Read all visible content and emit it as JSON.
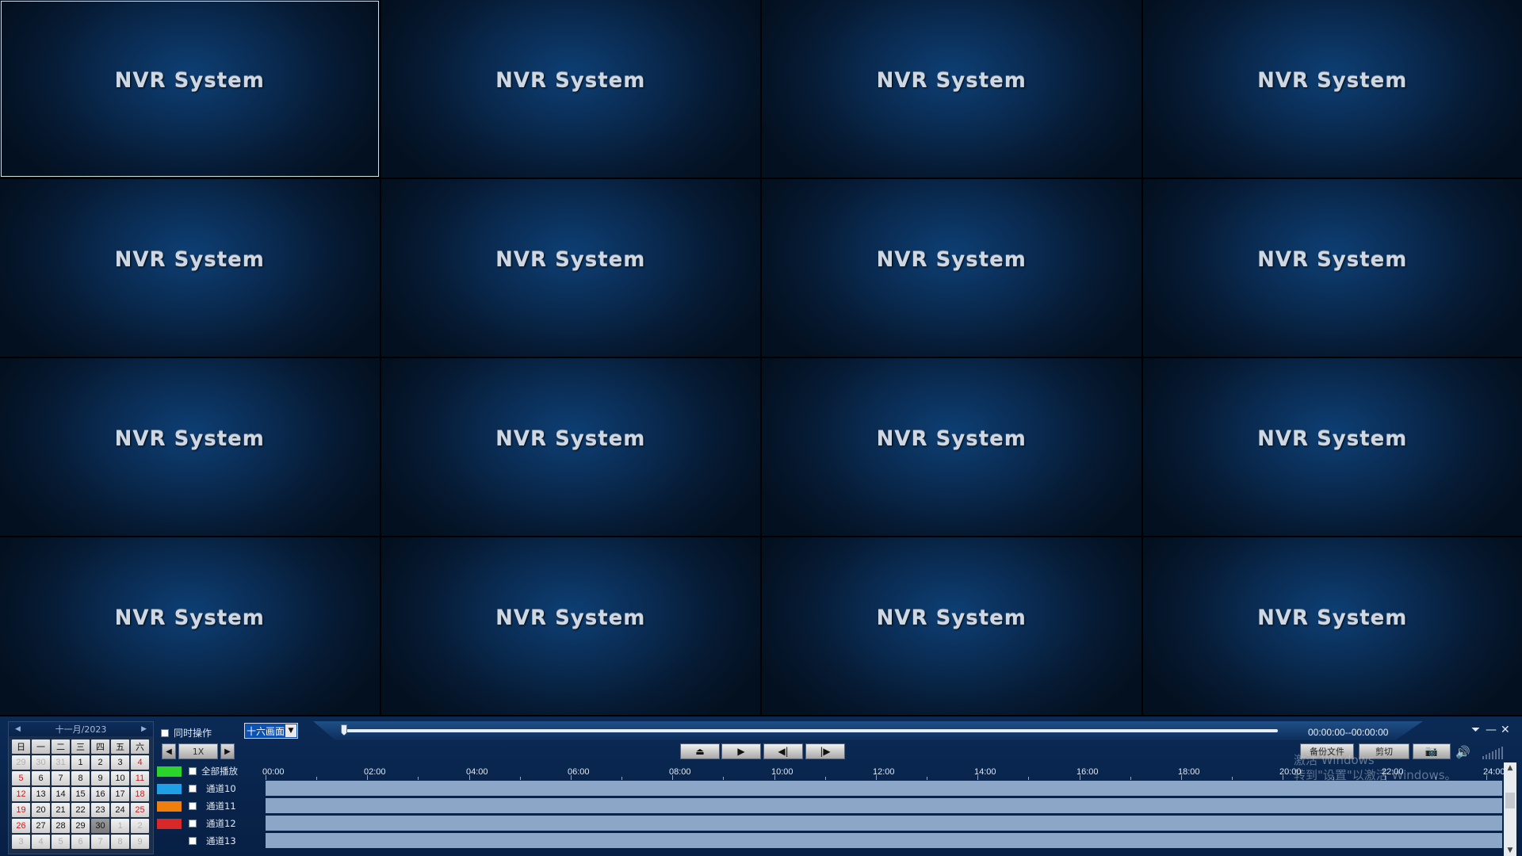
{
  "grid": {
    "tile_label": "NVR System",
    "tile_count": 16,
    "selected_index": 0
  },
  "calendar": {
    "month_label": "十一月/2023",
    "weekdays": [
      "日",
      "一",
      "二",
      "三",
      "四",
      "五",
      "六"
    ],
    "weeks": [
      [
        {
          "d": "29",
          "s": "dim"
        },
        {
          "d": "30",
          "s": "dim"
        },
        {
          "d": "31",
          "s": "dim"
        },
        {
          "d": "1",
          "s": ""
        },
        {
          "d": "2",
          "s": ""
        },
        {
          "d": "3",
          "s": ""
        },
        {
          "d": "4",
          "s": "red"
        }
      ],
      [
        {
          "d": "5",
          "s": "red"
        },
        {
          "d": "6",
          "s": ""
        },
        {
          "d": "7",
          "s": ""
        },
        {
          "d": "8",
          "s": ""
        },
        {
          "d": "9",
          "s": ""
        },
        {
          "d": "10",
          "s": ""
        },
        {
          "d": "11",
          "s": "red"
        }
      ],
      [
        {
          "d": "12",
          "s": "red"
        },
        {
          "d": "13",
          "s": ""
        },
        {
          "d": "14",
          "s": ""
        },
        {
          "d": "15",
          "s": ""
        },
        {
          "d": "16",
          "s": ""
        },
        {
          "d": "17",
          "s": ""
        },
        {
          "d": "18",
          "s": "red"
        }
      ],
      [
        {
          "d": "19",
          "s": "red"
        },
        {
          "d": "20",
          "s": ""
        },
        {
          "d": "21",
          "s": ""
        },
        {
          "d": "22",
          "s": ""
        },
        {
          "d": "23",
          "s": ""
        },
        {
          "d": "24",
          "s": ""
        },
        {
          "d": "25",
          "s": "red"
        }
      ],
      [
        {
          "d": "26",
          "s": "red"
        },
        {
          "d": "27",
          "s": ""
        },
        {
          "d": "28",
          "s": ""
        },
        {
          "d": "29",
          "s": ""
        },
        {
          "d": "30",
          "s": "today"
        },
        {
          "d": "1",
          "s": "dim"
        },
        {
          "d": "2",
          "s": "dim"
        }
      ],
      [
        {
          "d": "3",
          "s": "dim"
        },
        {
          "d": "4",
          "s": "dim"
        },
        {
          "d": "5",
          "s": "dim"
        },
        {
          "d": "6",
          "s": "dim"
        },
        {
          "d": "7",
          "s": "dim"
        },
        {
          "d": "8",
          "s": "dim"
        },
        {
          "d": "9",
          "s": "dim"
        }
      ]
    ]
  },
  "toolbar": {
    "sync_label": "同时操作",
    "layout_value": "十六画面",
    "time_range": "00:00:00--00:00:00",
    "speed": "1X",
    "backup_label": "备份文件",
    "cut_label": "剪切"
  },
  "timeline": {
    "all_play_label": "全部播放",
    "ticks": [
      "00:00",
      "02:00",
      "04:00",
      "06:00",
      "08:00",
      "10:00",
      "12:00",
      "14:00",
      "16:00",
      "18:00",
      "20:00",
      "22:00",
      "24:00"
    ],
    "channels": [
      "通道10",
      "通道11",
      "通道12",
      "通道13"
    ],
    "legend_colors": [
      "#2bd42b",
      "#1f9fe6",
      "#f07e0c",
      "#d92828"
    ]
  },
  "watermark": {
    "line1": "激活 Windows",
    "line2": "转到\"设置\"以激活 Windows。"
  }
}
